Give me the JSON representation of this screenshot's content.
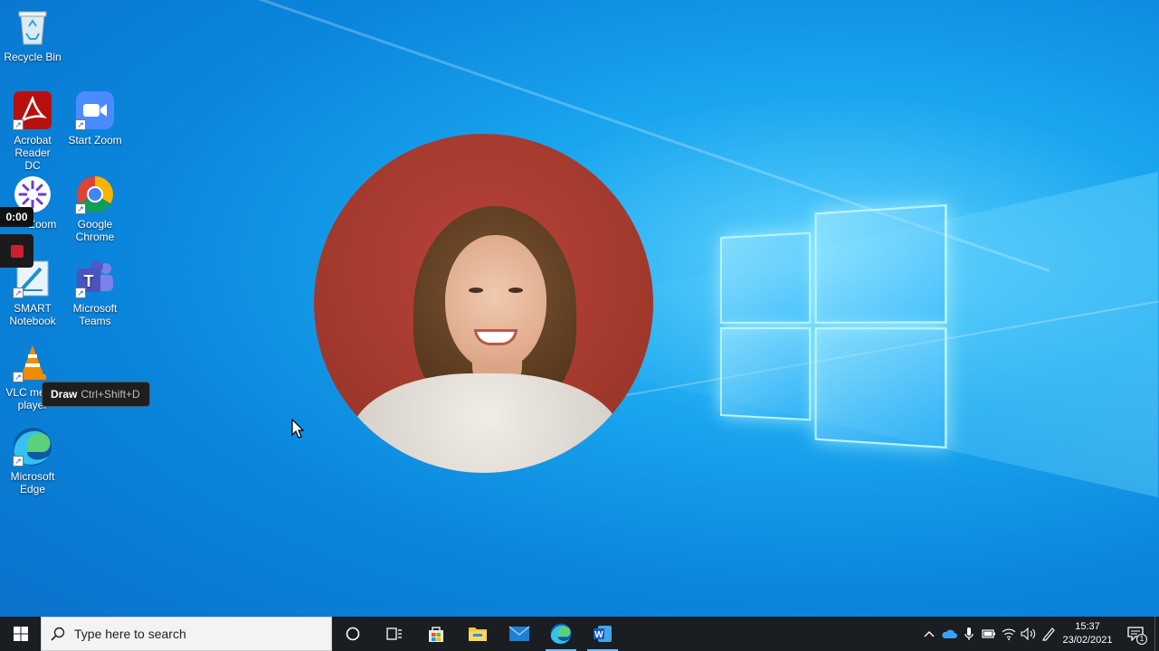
{
  "desktop": {
    "icons": [
      {
        "label": "Recycle Bin"
      },
      {
        "label": "Acrobat Reader DC"
      },
      {
        "label": "Start Zoom"
      },
      {
        "label": "Zoom"
      },
      {
        "label": "Google Chrome"
      },
      {
        "label": "SMART Notebook"
      },
      {
        "label": "Microsoft Teams"
      },
      {
        "label": "VLC media player"
      },
      {
        "label": "Microsoft Edge"
      }
    ]
  },
  "recorder": {
    "timer": "0:00"
  },
  "tooltip": {
    "title": "Draw",
    "shortcut": "Ctrl+Shift+D"
  },
  "taskbar": {
    "search_placeholder": "Type here to search",
    "apps": [
      {
        "icon": "cortana-icon"
      },
      {
        "icon": "task-view-icon"
      },
      {
        "icon": "microsoft-store-icon"
      },
      {
        "icon": "file-explorer-icon"
      },
      {
        "icon": "mail-icon"
      },
      {
        "icon": "edge-icon"
      },
      {
        "icon": "word-icon"
      }
    ],
    "clock": {
      "time": "15:37",
      "date": "23/02/2021"
    },
    "notification_count": "1"
  },
  "colors": {
    "taskbar": "#1a1d21",
    "accent": "#0a86dc"
  }
}
